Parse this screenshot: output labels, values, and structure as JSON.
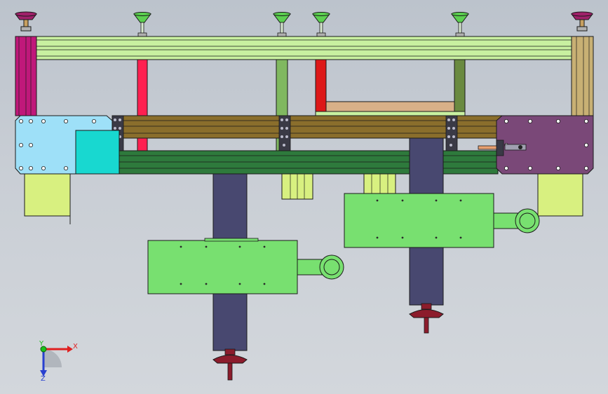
{
  "viewport": {
    "background": "#c6ccd3"
  },
  "triad": {
    "x_label": "X",
    "y_label": "Y",
    "z_label": "Z",
    "x_color": "#e02020",
    "y_color": "#1cc01c",
    "z_color": "#2840d0"
  },
  "colors": {
    "top_rail": "#c8f0a0",
    "left_post": "#c0187a",
    "right_post": "#c8b074",
    "left_plate": "#9ee0f8",
    "cyan_block": "#18d8d0",
    "right_plate": "#7a4878",
    "middle_beam": "#8a6e2c",
    "lower_beam": "#2e7a3c",
    "cylinder_body": "#484870",
    "cylinder_plate": "#78e070",
    "mount_block": "#d8f080",
    "red_column": "#ff2050",
    "dark_red_column": "#dd1818",
    "green_column": "#80b860",
    "olive_column": "#6a8a40",
    "tan_plank": "#d8b088",
    "magenta_cup": "#a0206a",
    "green_cup": "#5cd050",
    "handwheel": "#8c1c2c",
    "bracket": "#3a3a46",
    "outline": "#1a1a1a"
  },
  "components": [
    "top-rail",
    "left-post",
    "right-post",
    "leveling-feet",
    "vacuum-cups",
    "support-columns",
    "middle-beam",
    "lower-beam",
    "left-end-plate",
    "right-end-plate",
    "lift-cylinders",
    "cylinder-plates",
    "handwheels"
  ]
}
